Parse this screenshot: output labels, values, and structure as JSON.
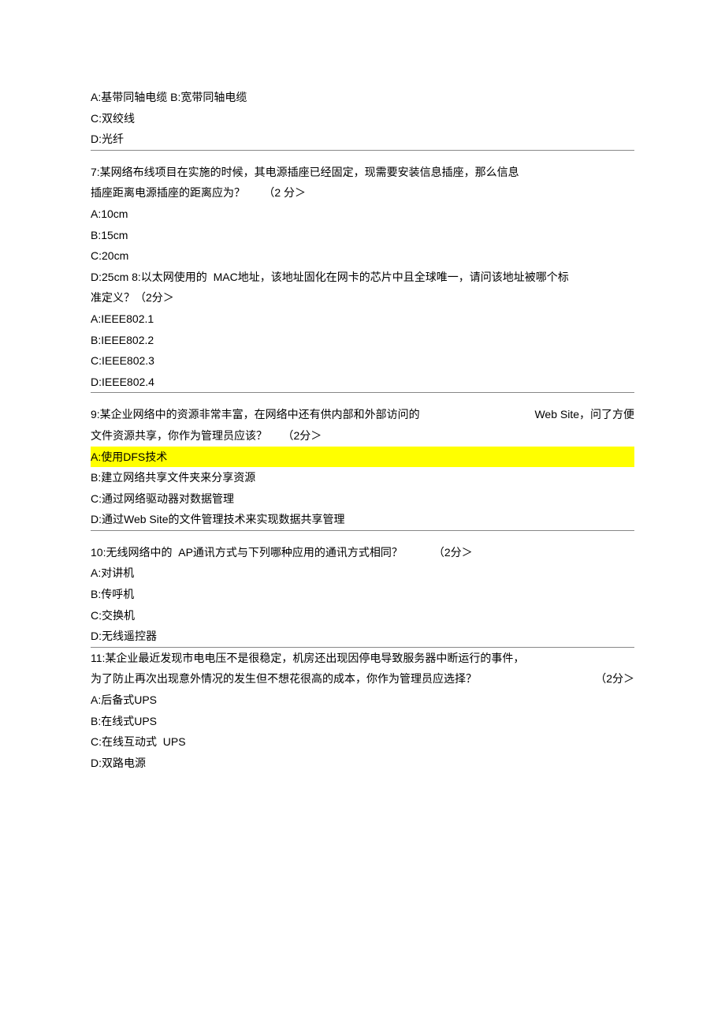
{
  "q6": {
    "optA": "A:基带同轴电缆 ",
    "optB": "B:宽带同轴电缆",
    "optC": "C:双绞线",
    "optD": "D:光纤"
  },
  "q7": {
    "text1": "7:某网络布线项目在实施的时候，其电源插座已经固定，现需要安装信息插座，那么信息",
    "text2l": "插座距离电源插座的距离应为？",
    "text2r": "（2 分＞",
    "optA": "A:10cm",
    "optB": "B:15cm",
    "optC": "C:20cm",
    "optDpre": "D:25cm ",
    "q8pre": "8:以太网使用的  MAC地址，该地址固化在网卡的芯片中且全球唯一，请问该地址被哪个标",
    "q8text2": "准定义？（2分＞"
  },
  "q8": {
    "optA": "A:IEEE802.1",
    "optB": "B:IEEE802.2",
    "optC": "C:IEEE802.3",
    "optD": "D:IEEE802.4"
  },
  "q9": {
    "text1l": "9:某企业网络中的资源非常丰富，在网络中还有供内部和外部访问的",
    "text1r": "Web Site，问了方便",
    "text2l": "文件资源共享，你作为管理员应该？",
    "text2r": "（2分＞",
    "optA": "A:使用DFS技术",
    "optB": "B:建立网络共享文件夹来分享资源",
    "optC": "C:通过网络驱动器对数据管理",
    "optD": "D:通过Web Site的文件管理技术来实现数据共享管理"
  },
  "q10": {
    "text1l": "10:无线网络中的  AP通讯方式与下列哪种应用的通讯方式相同？",
    "text1r": "（2分＞",
    "optA": "A:对讲机",
    "optB": "B:传呼机",
    "optC": "C:交换机",
    "optD": "D:无线遥控器"
  },
  "q11": {
    "text1": "11:某企业最近发现市电电压不是很稳定，机房还出现因停电导致服务器中断运行的事件，",
    "text2l": "为了防止再次出现意外情况的发生但不想花很高的成本，你作为管理员应选择？",
    "text2r": "（2分＞",
    "optA": "A:后备式UPS",
    "optB": "B:在线式UPS",
    "optC": "C:在线互动式  UPS",
    "optD": "D:双路电源"
  }
}
